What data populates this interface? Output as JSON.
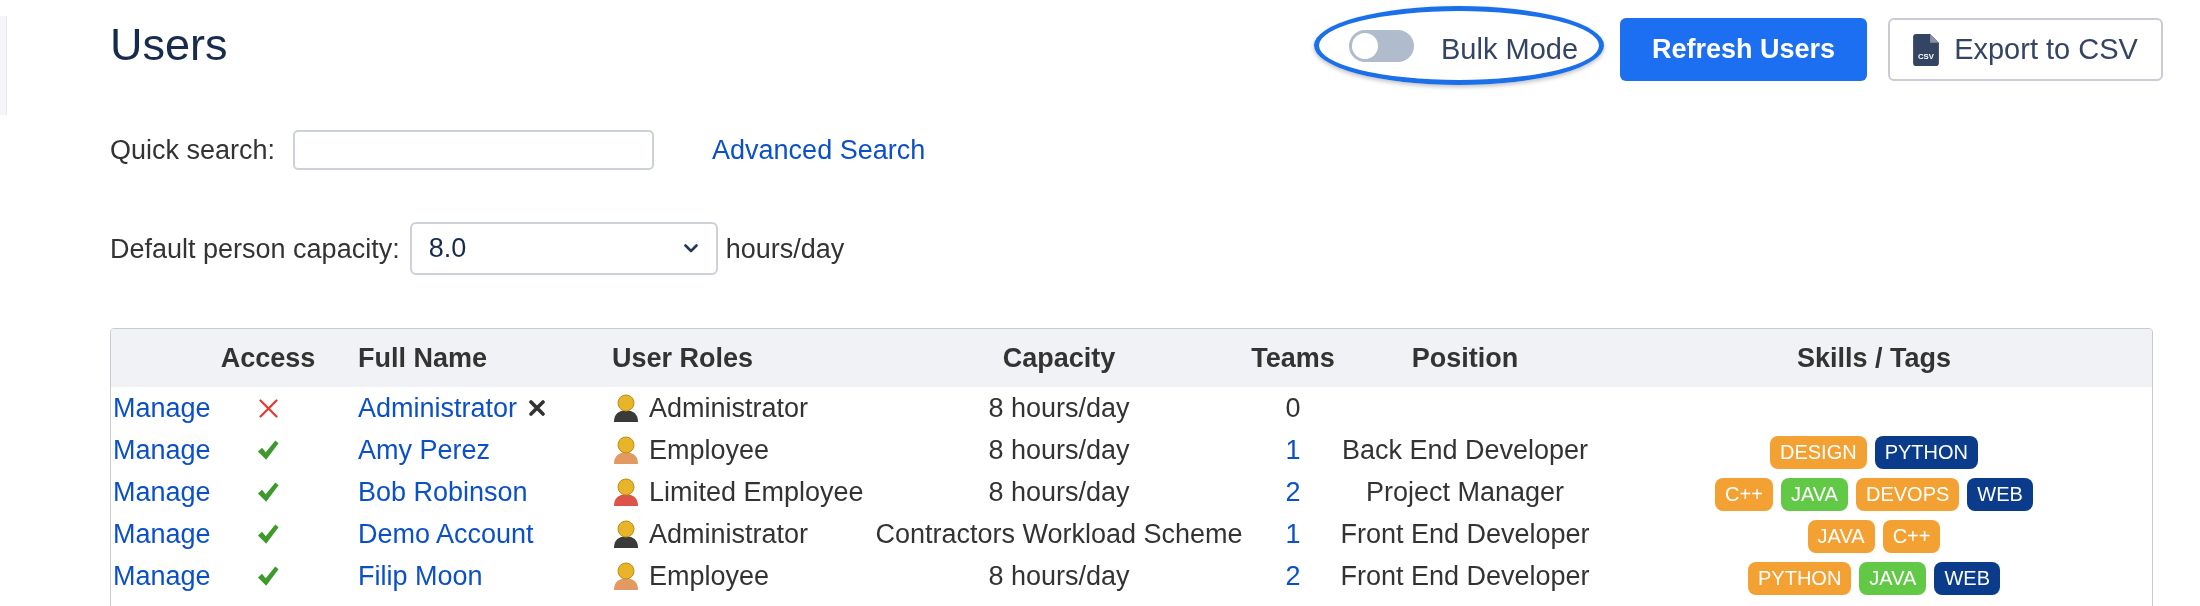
{
  "page": {
    "title": "Users"
  },
  "bulk_mode": {
    "label": "Bulk Mode",
    "on": false,
    "highlighted": true
  },
  "refresh_button": {
    "label": "Refresh Users"
  },
  "export_button": {
    "label": "Export to CSV",
    "icon_text": "CSV"
  },
  "quick_search": {
    "label": "Quick search:"
  },
  "advanced_search": {
    "label": "Advanced Search"
  },
  "capacity": {
    "label": "Default person capacity:",
    "value": "8.0",
    "unit": "hours/day"
  },
  "table": {
    "columns": [
      "Access",
      "Full Name",
      "User Roles",
      "Capacity",
      "Teams",
      "Position",
      "Skills / Tags"
    ],
    "rows": [
      {
        "action": "Manage",
        "access": false,
        "name": "Administrator",
        "x_mark": true,
        "role": {
          "label": "Administrator",
          "color": "#3a3a3a"
        },
        "capacity": "8 hours/day",
        "teams": {
          "count": "0",
          "link": false
        }
      },
      {
        "action": "Manage",
        "access": true,
        "name": "Amy Perez",
        "x_mark": false,
        "role": {
          "label": "Employee",
          "color": "#e39a62"
        },
        "capacity": "8 hours/day",
        "teams": {
          "count": "1",
          "link": true
        },
        "position": "Back End Developer",
        "tags": [
          {
            "label": "DESIGN",
            "color": "#f4a134"
          },
          {
            "label": "PYTHON",
            "color": "#0b3c8c"
          }
        ]
      },
      {
        "action": "Manage",
        "access": true,
        "name": "Bob Robinson",
        "x_mark": false,
        "role": {
          "label": "Limited Employee",
          "color": "#dc5448"
        },
        "capacity": "8 hours/day",
        "teams": {
          "count": "2",
          "link": true
        },
        "position": "Project Manager",
        "tags": [
          {
            "label": "C++",
            "color": "#f4a134"
          },
          {
            "label": "JAVA",
            "color": "#62c947"
          },
          {
            "label": "DEVOPS",
            "color": "#f4a134"
          },
          {
            "label": "WEB",
            "color": "#0b3c8c"
          }
        ]
      },
      {
        "action": "Manage",
        "access": true,
        "name": "Demo Account",
        "x_mark": false,
        "role": {
          "label": "Administrator",
          "color": "#3a3a3a"
        },
        "capacity": "Contractors Workload Scheme",
        "teams": {
          "count": "1",
          "link": true
        },
        "position": "Front End Developer",
        "tags": [
          {
            "label": "JAVA",
            "color": "#f4a134"
          },
          {
            "label": "C++",
            "color": "#f4a134"
          }
        ]
      },
      {
        "action": "Manage",
        "access": true,
        "name": "Filip Moon",
        "x_mark": false,
        "role": {
          "label": "Employee",
          "color": "#e39a62"
        },
        "capacity": "8 hours/day",
        "teams": {
          "count": "2",
          "link": true
        },
        "position": "Front End Developer",
        "tags": [
          {
            "label": "PYTHON",
            "color": "#f4a134"
          },
          {
            "label": "JAVA",
            "color": "#62c947"
          },
          {
            "label": "WEB",
            "color": "#0b3c8c"
          }
        ]
      }
    ]
  }
}
